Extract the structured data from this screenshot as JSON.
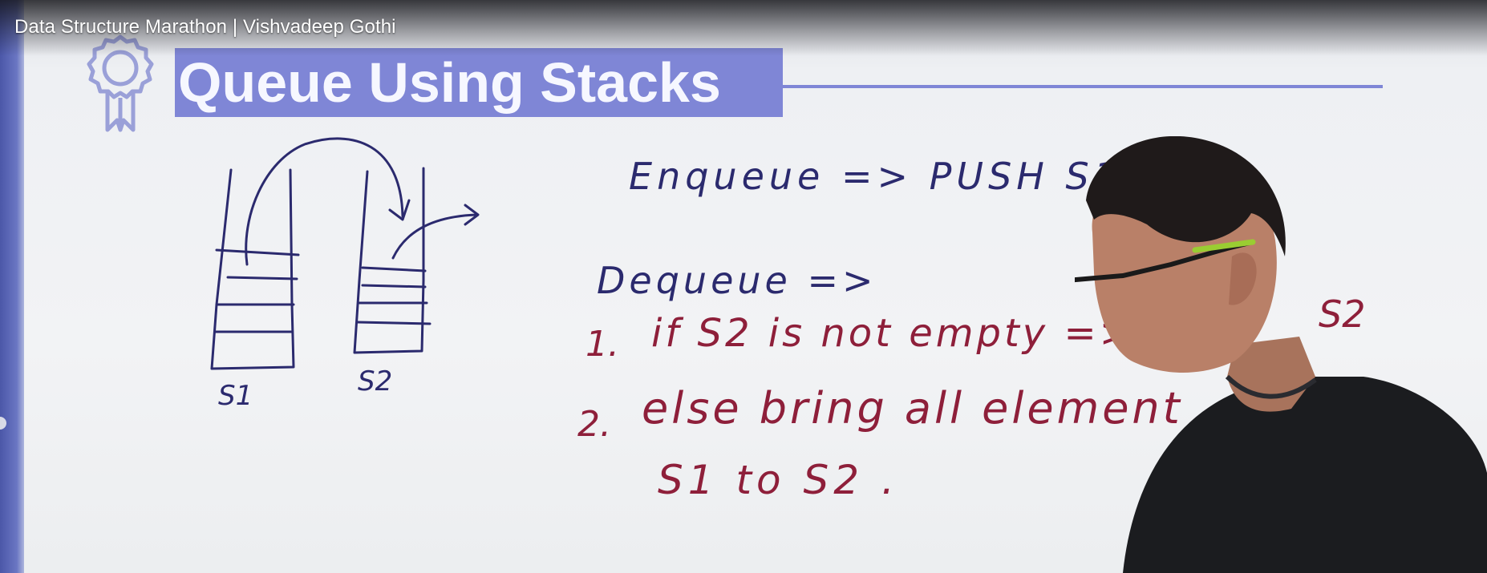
{
  "video": {
    "title": "Data Structure Marathon | Vishvadeep Gothi"
  },
  "slide": {
    "heading": "Queue Using Stacks"
  },
  "whiteboard": {
    "stack_labels": [
      "S1",
      "S2"
    ],
    "enqueue_line": "Enqueue => PUSH S1",
    "dequeue_line": "Dequeue =>",
    "step1_number": "1.",
    "step1_text": "if S2 is not empty =>",
    "step1_tail": "S2",
    "step2_number": "2.",
    "step2_text": "else bring all element",
    "step2_cont": "S1 to S2 ."
  },
  "colors": {
    "heading_bg": "#7f86d6",
    "ink_blue": "#2b2a6e",
    "ink_red": "#8e1f3a"
  },
  "icons": {
    "badge": "award-ribbon-icon"
  }
}
